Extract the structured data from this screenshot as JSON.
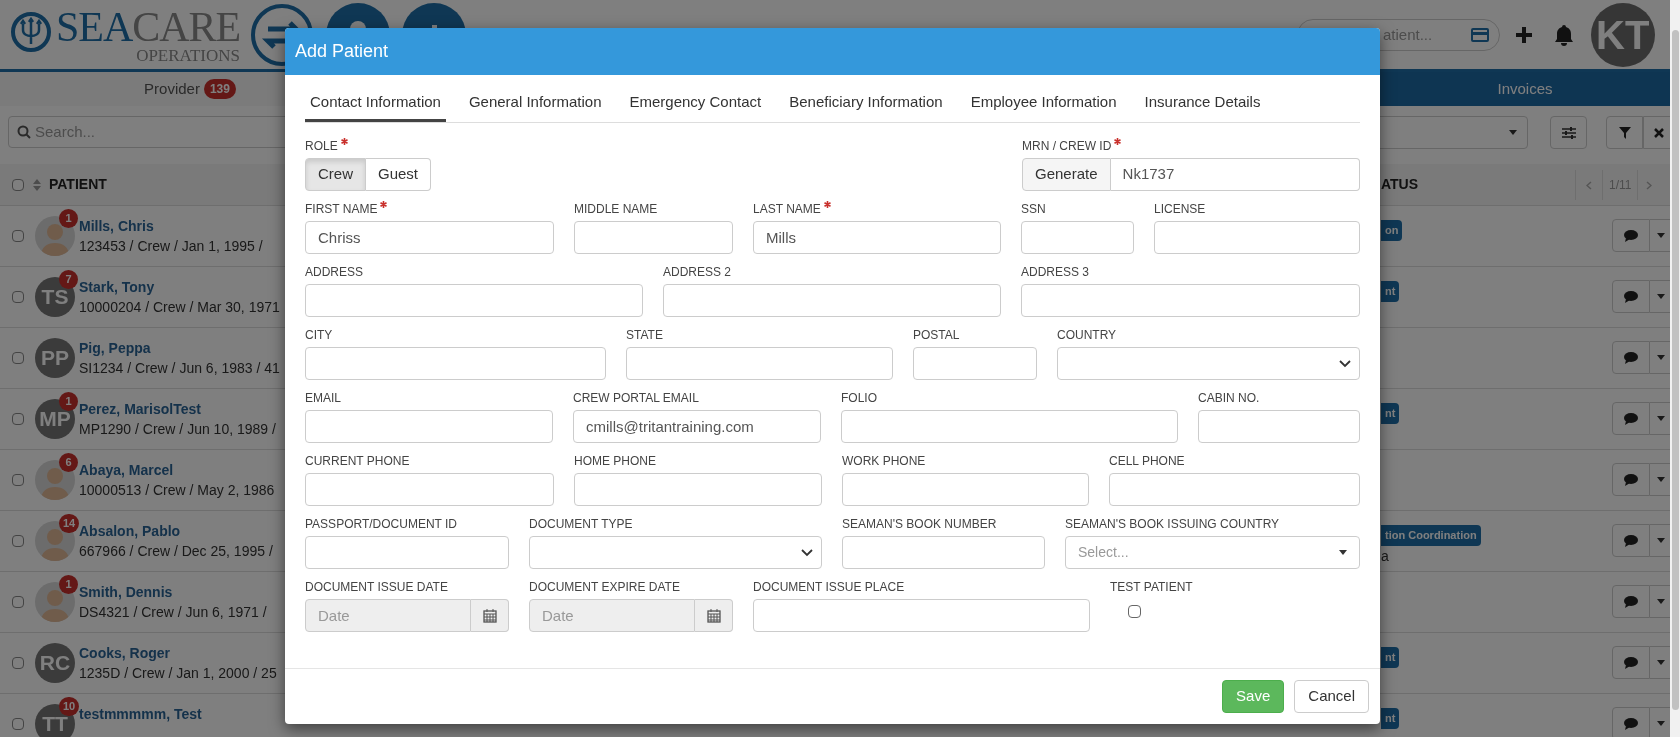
{
  "app": {
    "logo": {
      "brand_main": "SEA",
      "brand_accent": "CARE",
      "tagline": "OPERATIONS"
    },
    "header_search": {
      "placeholder": "atient..."
    },
    "user_avatar": {
      "initials": "KT"
    },
    "nav_tabs": [
      {
        "label": "Provider",
        "count": "139",
        "selected": true
      },
      {
        "label": "Invoices",
        "selected": false
      }
    ],
    "list_search": {
      "placeholder": "Search..."
    },
    "table": {
      "columns": [
        "PATIENT",
        "ATUS"
      ],
      "page": "1/11",
      "select_all_checked": false,
      "rows": [
        {
          "checked": false,
          "name": "Mills, Chris",
          "details": "123453 / Crew / Jan 1, 1995 /",
          "avatar": {
            "kind": "photo"
          },
          "count": "1",
          "status": "on"
        },
        {
          "checked": false,
          "name": "Stark, Tony",
          "details": "10000204 / Crew / Mar 30, 1971",
          "avatar": {
            "kind": "initials",
            "initials": "TS"
          },
          "count": "7",
          "status": "nt"
        },
        {
          "checked": false,
          "name": "Pig, Peppa",
          "details": "SI1234 / Crew / Jun 6, 1983 / 41",
          "avatar": {
            "kind": "initials",
            "initials": "PP"
          }
        },
        {
          "checked": false,
          "name": "Perez, MarisolTest",
          "details": "MP1290 / Crew / Jun 10, 1989 /",
          "avatar": {
            "kind": "initials",
            "initials": "MP"
          },
          "count": "1",
          "status": "nt"
        },
        {
          "checked": false,
          "name": "Abaya, Marcel",
          "details": "10000513 / Crew / May 2, 1986",
          "avatar": {
            "kind": "photo"
          },
          "count": "6"
        },
        {
          "checked": false,
          "name": "Absalon, Pablo",
          "details": "667966 / Crew / Dec 25, 1995 /",
          "avatar": {
            "kind": "photo"
          },
          "count": "14",
          "status": "tion Coordination",
          "status_note": "a"
        },
        {
          "checked": false,
          "name": "Smith, Dennis",
          "details": "DS4321 / Crew / Jun 6, 1971 /",
          "avatar": {
            "kind": "photo"
          },
          "count": "1"
        },
        {
          "checked": false,
          "name": "Cooks, Roger",
          "details": "1235D / Crew / Jan 1, 2000 / 25",
          "avatar": {
            "kind": "initials",
            "initials": "RC"
          },
          "status": "nt"
        },
        {
          "checked": false,
          "name": "testmmmmm, Test",
          "avatar": {
            "kind": "initials",
            "initials": "TT"
          },
          "count": "10",
          "status": "nt"
        }
      ]
    }
  },
  "dialog": {
    "title": "Add Patient",
    "tabs": [
      {
        "label": "Contact Information",
        "selected": true
      },
      {
        "label": "General Information",
        "selected": false
      },
      {
        "label": "Emergency Contact",
        "selected": false
      },
      {
        "label": "Beneficiary Information",
        "selected": false
      },
      {
        "label": "Employee Information",
        "selected": false
      },
      {
        "label": "Insurance Details",
        "selected": false
      }
    ],
    "role": {
      "kind": "toggle",
      "label": "ROLE",
      "required": true,
      "options": [
        {
          "label": "Crew",
          "selected": true
        },
        {
          "label": "Guest",
          "selected": false
        }
      ]
    },
    "crew_id": {
      "kind": "generate",
      "label": "MRN / CREW ID",
      "required": true,
      "button": "Generate",
      "value": "Nk1737"
    },
    "rows": [
      [
        {
          "kind": "text",
          "label": "FIRST NAME",
          "required": true,
          "value": "Chriss"
        },
        {
          "kind": "text",
          "label": "MIDDLE NAME"
        },
        {
          "kind": "text",
          "label": "LAST NAME",
          "required": true,
          "value": "Mills"
        },
        {
          "kind": "text",
          "label": "SSN"
        },
        {
          "kind": "text",
          "label": "LICENSE"
        }
      ],
      [
        {
          "kind": "text",
          "label": "ADDRESS"
        },
        {
          "kind": "text",
          "label": "ADDRESS 2"
        },
        {
          "kind": "text",
          "label": "ADDRESS 3"
        }
      ],
      [
        {
          "kind": "text",
          "label": "CITY"
        },
        {
          "kind": "text",
          "label": "STATE"
        },
        {
          "kind": "text",
          "label": "POSTAL"
        },
        {
          "kind": "select",
          "label": "COUNTRY"
        }
      ],
      [
        {
          "kind": "text",
          "label": "EMAIL"
        },
        {
          "kind": "text",
          "label": "CREW PORTAL EMAIL",
          "value": "cmills@tritantraining.com"
        },
        {
          "kind": "text",
          "label": "FOLIO"
        },
        {
          "kind": "text",
          "label": "CABIN NO."
        }
      ],
      [
        {
          "kind": "text",
          "label": "CURRENT PHONE"
        },
        {
          "kind": "text",
          "label": "HOME PHONE"
        },
        {
          "kind": "text",
          "label": "WORK PHONE"
        },
        {
          "kind": "text",
          "label": "CELL PHONE"
        }
      ],
      [
        {
          "kind": "text",
          "label": "PASSPORT/DOCUMENT ID"
        },
        {
          "kind": "select",
          "label": "DOCUMENT TYPE"
        },
        {
          "kind": "text",
          "label": "SEAMAN'S BOOK NUMBER"
        },
        {
          "kind": "combo",
          "label": "SEAMAN'S BOOK ISSUING COUNTRY",
          "placeholder": "Select..."
        }
      ],
      [
        {
          "kind": "date",
          "label": "DOCUMENT ISSUE DATE",
          "placeholder": "Date",
          "disabled": true
        },
        {
          "kind": "date",
          "label": "DOCUMENT EXPIRE DATE",
          "placeholder": "Date",
          "disabled": true
        },
        {
          "kind": "text",
          "label": "DOCUMENT ISSUE PLACE"
        },
        {
          "kind": "checkbox",
          "label": "TEST PATIENT",
          "checked": false
        }
      ]
    ],
    "buttons": [
      {
        "label": "Save",
        "kind": "primary"
      },
      {
        "label": "Cancel",
        "kind": "default"
      }
    ]
  }
}
